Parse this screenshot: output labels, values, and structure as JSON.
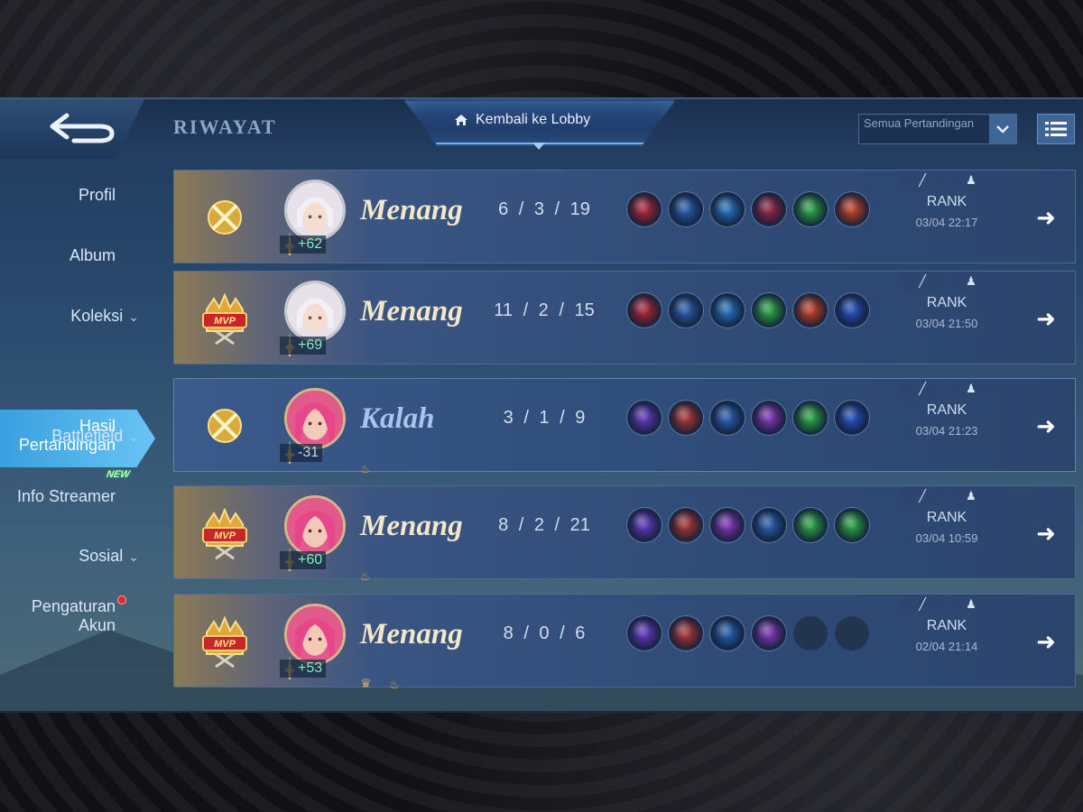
{
  "header": {
    "title": "RIWAYAT",
    "lobby_label": "Kembali ke Lobby",
    "filter_value": "Semua Pertandingan"
  },
  "sidebar": {
    "items": [
      {
        "label": "Profil"
      },
      {
        "label": "Album"
      },
      {
        "label": "Koleksi"
      },
      {
        "label": "Hasil Pertandingan",
        "active": true
      },
      {
        "label": "Battlefield",
        "badge": "NEW"
      },
      {
        "label": "Info Streamer"
      },
      {
        "label": "Sosial"
      },
      {
        "label": "Pengaturan Akun",
        "notification": true
      }
    ]
  },
  "matches": [
    {
      "result": "Menang",
      "kda": "6 / 3 / 19",
      "points": "+62",
      "mvp": false,
      "mode": "RANK",
      "date": "03/04 22:17",
      "hero": "silver-haired",
      "items": [
        "#c0283a",
        "#2c64b8",
        "#2a7ac8",
        "#a0284a",
        "#2fb34a",
        "#d5462a"
      ]
    },
    {
      "result": "Menang",
      "kda": "11 / 2 / 15",
      "points": "+69",
      "mvp": true,
      "mode": "RANK",
      "date": "03/04 21:50",
      "hero": "silver-haired",
      "items": [
        "#c0283a",
        "#2c64b8",
        "#2a7ac8",
        "#2fb34a",
        "#d5462a",
        "#2a55c8"
      ]
    },
    {
      "result": "Kalah",
      "kda": "3 / 1 / 9",
      "points": "-31",
      "mvp": false,
      "mode": "RANK",
      "date": "03/04 21:23",
      "hero": "pink-haired",
      "items": [
        "#6a3cc8",
        "#b83a3a",
        "#2c64b8",
        "#8a3ac0",
        "#2fb34a",
        "#2a55c8"
      ],
      "fire": true
    },
    {
      "result": "Menang",
      "kda": "8 / 2 / 21",
      "points": "+60",
      "mvp": true,
      "mode": "RANK",
      "date": "03/04 10:59",
      "hero": "pink-haired",
      "items": [
        "#6a3cc8",
        "#b83a3a",
        "#8a3ac0",
        "#2c64b8",
        "#2fb34a",
        "#2fb34a"
      ],
      "fire": true
    },
    {
      "result": "Menang",
      "kda": "8 / 0 / 6",
      "points": "+53",
      "mvp": true,
      "mode": "RANK",
      "date": "02/04 21:14",
      "hero": "pink-haired",
      "items": [
        "#6a3cc8",
        "#b83a3a",
        "#2c64b8",
        "#8a3ac0",
        "",
        ""
      ],
      "fire": true,
      "crown": true
    }
  ],
  "icons": {
    "back": "back-arrow-icon",
    "home": "home-icon",
    "dropdown": "chevron-down-icon",
    "list": "list-icon",
    "detail": "arrow-right-icon"
  },
  "colors": {
    "accent": "#6fb3ff",
    "win_text": "#f4e6c8",
    "lose_text": "#a8c4ec",
    "points_positive": "#7ef0b8"
  }
}
